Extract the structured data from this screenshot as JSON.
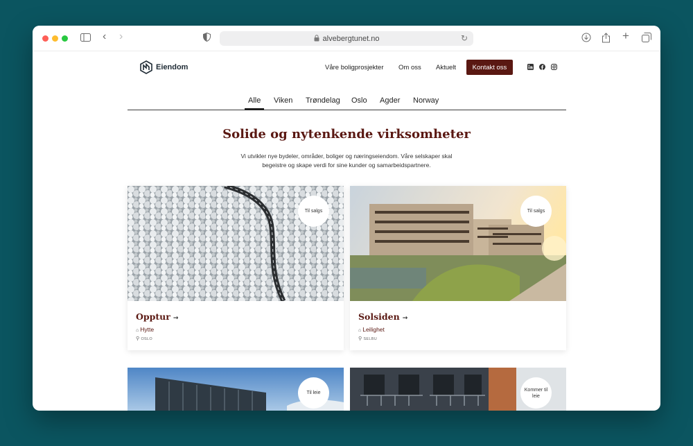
{
  "browser": {
    "url": "alvebergtunet.no"
  },
  "site": {
    "logo_text": "Eiendom",
    "nav": [
      {
        "label": "Våre boligprosjekter"
      },
      {
        "label": "Om oss"
      },
      {
        "label": "Aktuelt"
      }
    ],
    "cta_label": "Kontakt oss",
    "social_icons": [
      "linkedin-icon",
      "facebook-icon",
      "instagram-icon"
    ],
    "brand_color": "#5a1812"
  },
  "tabs": [
    {
      "label": "Alle",
      "active": true
    },
    {
      "label": "Viken"
    },
    {
      "label": "Trøndelag"
    },
    {
      "label": "Oslo"
    },
    {
      "label": "Agder"
    },
    {
      "label": "Norway"
    }
  ],
  "headline": "Solide og nytenkende virksomheter",
  "intro_line1": "Vi utvikler nye bydeler, områder, boliger og næringseiendom. Våre selskaper skal",
  "intro_line2": "begeistre og skape verdi for sine kunder og samarbeidspartnere.",
  "cards": [
    {
      "title": "Opptur",
      "type": "Hytte",
      "location": "OSLO",
      "badge": "Til salgs"
    },
    {
      "title": "Solsiden",
      "type": "Leilighet",
      "location": "SELBU",
      "badge": "Til salgs"
    },
    {
      "badge": "Til leie"
    },
    {
      "badge": "Kommer til leie"
    }
  ]
}
